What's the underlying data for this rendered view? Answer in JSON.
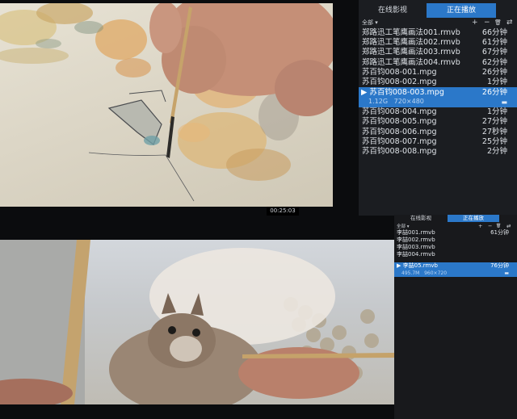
{
  "top_player": {
    "time": "00:25:03",
    "tabs": [
      "在线影视",
      "正在播放"
    ],
    "filter_label": "全部",
    "tools": [
      "add-icon",
      "minus-icon",
      "trash-icon",
      "swap-icon"
    ],
    "tool_glyphs": [
      "+",
      "−",
      "🗑",
      "⇄"
    ],
    "playlist": [
      {
        "name": "郑路迅工笔鹰画法001.rmvb",
        "duration": "66分钟"
      },
      {
        "name": "郑路迅工笔鹰画法002.rmvb",
        "duration": "61分钟"
      },
      {
        "name": "郑路迅工笔鹰画法003.rmvb",
        "duration": "67分钟"
      },
      {
        "name": "郑路迅工笔鹰画法004.rmvb",
        "duration": "62分钟"
      },
      {
        "name": "苏百钧008-001.mpg",
        "duration": "26分钟"
      },
      {
        "name": "苏百钧008-002.mpg",
        "duration": "1分钟"
      }
    ],
    "selected": {
      "name": "苏百钧008-003.mpg",
      "duration": "26分钟",
      "size": "1.12G",
      "resolution": "720×480"
    },
    "playlist_after": [
      {
        "name": "苏百钧008-004.mpg",
        "duration": "1分钟"
      },
      {
        "name": "苏百钧008-005.mpg",
        "duration": "27分钟"
      },
      {
        "name": "苏百钧008-006.mpg",
        "duration": "27秒钟"
      },
      {
        "name": "苏百钧008-007.mpg",
        "duration": "25分钟"
      },
      {
        "name": "苏百钧008-008.mpg",
        "duration": "2分钟"
      }
    ]
  },
  "bottom_player": {
    "tabs": [
      "在线影视",
      "正在播放"
    ],
    "filter_label": "全部",
    "tool_glyphs": [
      "+",
      "−",
      "🗑",
      "⇄"
    ],
    "playlist": [
      {
        "name": "李喆001.rmvb",
        "duration": "61分钟"
      },
      {
        "name": "李喆002.rmvb",
        "duration": ""
      },
      {
        "name": "李喆003.rmvb",
        "duration": ""
      },
      {
        "name": "李喆004.rmvb",
        "duration": ""
      }
    ],
    "selected": {
      "name": "李喆05.rmvb",
      "duration": "76分钟",
      "size": "495.7M",
      "resolution": "960×720"
    }
  },
  "colors": {
    "accent": "#2b78c9",
    "panel": "#1b1d21",
    "background": "#0b0c0e"
  }
}
